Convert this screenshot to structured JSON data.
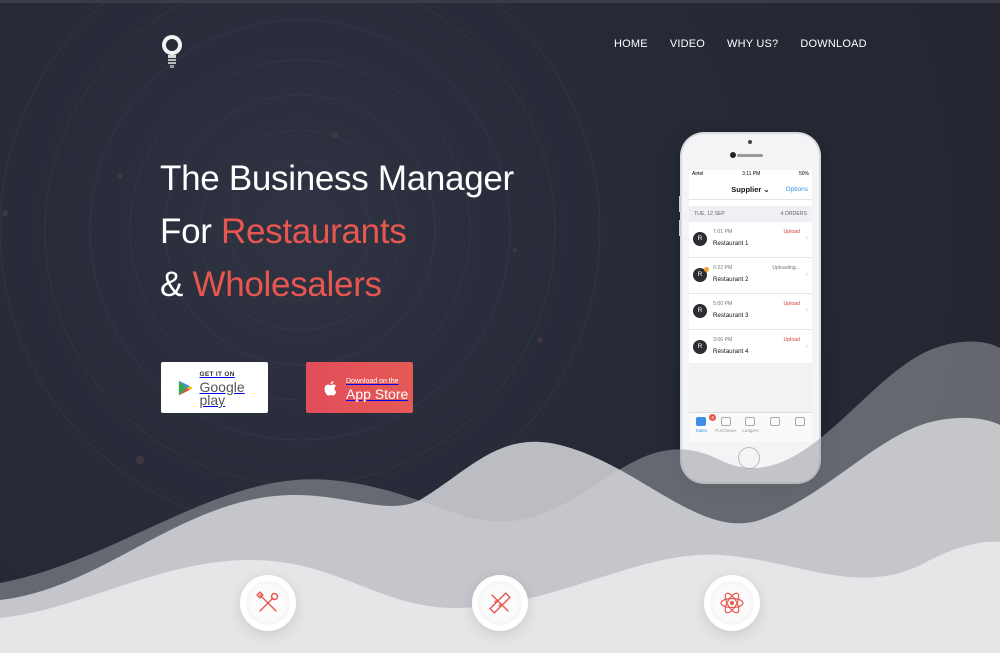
{
  "nav": {
    "home": "HOME",
    "video": "VIDEO",
    "why_us": "WHY US?",
    "download": "DOWNLOAD"
  },
  "hero": {
    "line1": "The Business Manager",
    "line2_prefix": "For ",
    "line2_accent": "Restaurants",
    "line3_prefix": "& ",
    "line3_accent": "Wholesalers"
  },
  "buttons": {
    "google_small": "GET IT ON",
    "google_big": "Google play",
    "apple_small": "Download on the",
    "apple_big": "App Store"
  },
  "phone": {
    "carrier": "Airtel",
    "time": "3:11 PM",
    "battery": "50%",
    "title": "Supplier",
    "options": "Options",
    "date": "TUE, 12 SEP",
    "order_count": "4 ORDERS",
    "orders": [
      {
        "initial": "R",
        "time": "7:01 PM",
        "name": "Restaurant 1",
        "status": "Upload"
      },
      {
        "initial": "R",
        "time": "6:22 PM",
        "name": "Restaurant 2",
        "status": "Uploading..."
      },
      {
        "initial": "R",
        "time": "5:00 PM",
        "name": "Restaurant 3",
        "status": "Upload"
      },
      {
        "initial": "R",
        "time": "3:06 PM",
        "name": "Restaurant 4",
        "status": "Upload"
      }
    ],
    "tabs": [
      {
        "label": "Sales",
        "badge": "4"
      },
      {
        "label": "Purchases"
      },
      {
        "label": "Ledgers"
      },
      {
        "label": ""
      },
      {
        "label": ""
      }
    ]
  },
  "colors": {
    "background": "#262a37",
    "accent": "#e8574f",
    "link_blue": "#3b8fe8"
  },
  "icons": {
    "logo": "lightbulb-icon",
    "feature1": "tools-icon",
    "feature2": "pencil-ruler-icon",
    "feature3": "atom-icon"
  }
}
